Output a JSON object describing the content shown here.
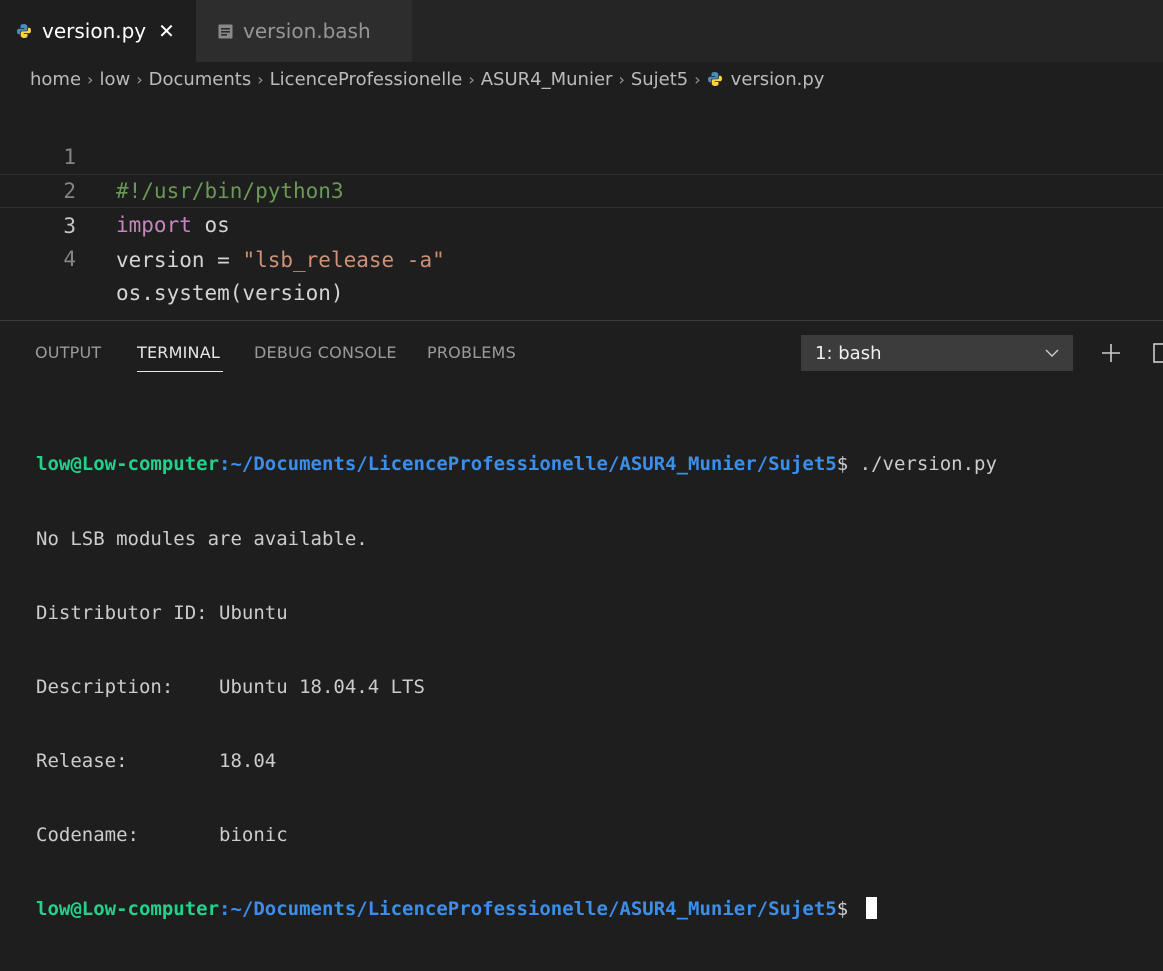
{
  "tabs": [
    {
      "label": "version.py",
      "icon": "python-icon",
      "active": true,
      "close": "✕"
    },
    {
      "label": "version.bash",
      "icon": "file-lines-icon",
      "active": false
    }
  ],
  "breadcrumb": {
    "parts": [
      "home",
      "low",
      "Documents",
      "LicenceProfessionelle",
      "ASUR4_Munier",
      "Sujet5"
    ],
    "file": "version.py",
    "separator": "›"
  },
  "editor": {
    "lines": [
      {
        "num": "1",
        "tokens": [
          {
            "text": "#!/usr/bin/python3",
            "color": "#6a9955"
          }
        ]
      },
      {
        "num": "2",
        "tokens": [
          {
            "text": "import",
            "color": "#c586c0"
          },
          {
            "text": " os",
            "color": "#d4d4d4"
          }
        ]
      },
      {
        "num": "3",
        "current": true,
        "tokens": [
          {
            "text": "version = ",
            "color": "#d4d4d4"
          },
          {
            "text": "\"lsb_release -a\"",
            "color": "#ce9178"
          }
        ]
      },
      {
        "num": "4",
        "tokens": [
          {
            "text": "os.system(version)",
            "color": "#d4d4d4"
          }
        ]
      }
    ]
  },
  "panel": {
    "tabs": [
      "OUTPUT",
      "TERMINAL",
      "DEBUG CONSOLE",
      "PROBLEMS"
    ],
    "active_tab": "TERMINAL",
    "terminal_select": "1: bash",
    "add_icon": "+"
  },
  "terminal": {
    "user": "low@Low-computer",
    "path": ":~/Documents/LicenceProfessionelle/ASUR4_Munier/Sujet5",
    "prompt_end": "$ ",
    "command": "./version.py",
    "output": [
      "No LSB modules are available.",
      "Distributor ID: Ubuntu",
      "Description:    Ubuntu 18.04.4 LTS",
      "Release:        18.04",
      "Codename:       bionic"
    ]
  },
  "colors": {
    "user": "#23d18b",
    "path": "#3b8eea",
    "background": "#1e1e1e"
  }
}
